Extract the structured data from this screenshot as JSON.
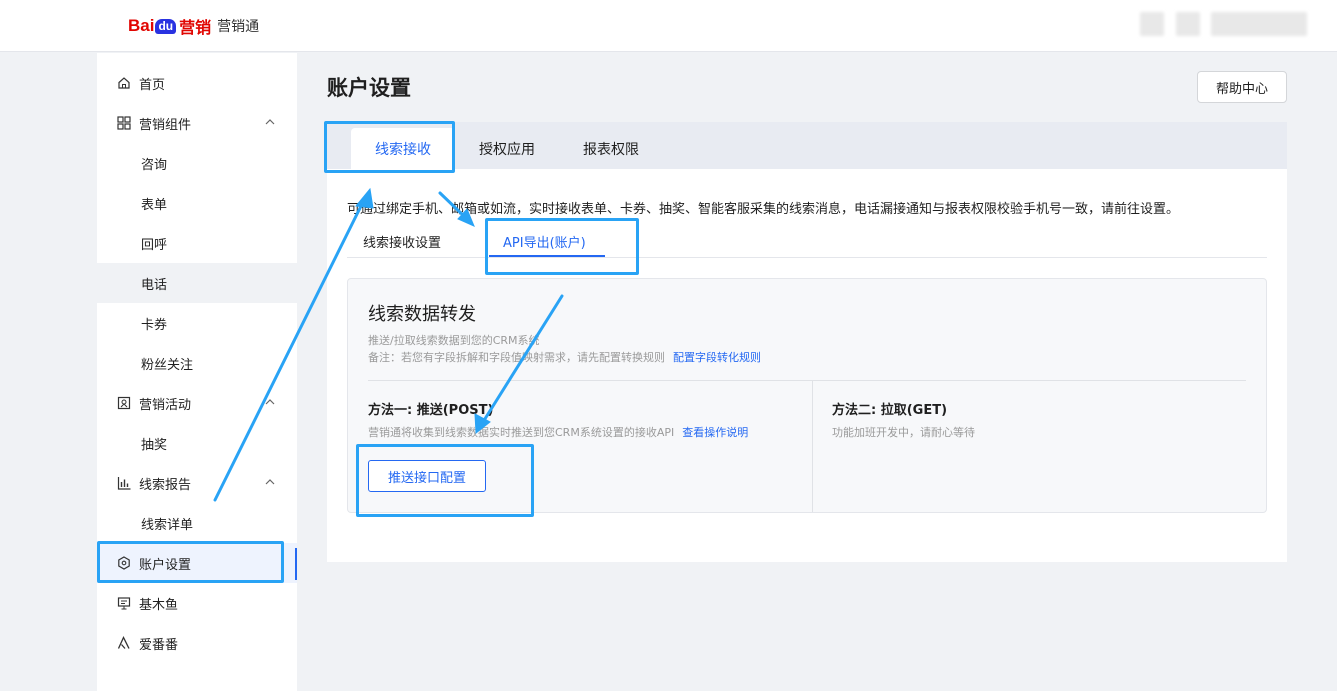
{
  "header": {
    "logo": {
      "bai": "Bai",
      "du": "du",
      "yingxiao": "营销",
      "product": "营销通"
    }
  },
  "sidebar": {
    "items": [
      {
        "label": "首页",
        "icon": "home-icon"
      },
      {
        "label": "营销组件",
        "icon": "grid-icon",
        "expanded": true
      },
      {
        "label": "咨询"
      },
      {
        "label": "表单"
      },
      {
        "label": "回呼"
      },
      {
        "label": "电话"
      },
      {
        "label": "卡券"
      },
      {
        "label": "粉丝关注"
      },
      {
        "label": "营销活动",
        "icon": "activity-icon",
        "expanded": true
      },
      {
        "label": "抽奖"
      },
      {
        "label": "线索报告",
        "icon": "bar-chart-icon",
        "expanded": true
      },
      {
        "label": "线索详单"
      },
      {
        "label": "账户设置",
        "icon": "settings-icon",
        "active": true
      },
      {
        "label": "基木鱼",
        "icon": "monitor-icon"
      },
      {
        "label": "爱番番",
        "icon": "aifanfan-icon"
      }
    ]
  },
  "main": {
    "title": "账户设置",
    "help_label": "帮助中心",
    "tabs": [
      "线索接收",
      "授权应用",
      "报表权限"
    ],
    "notice": "可通过绑定手机、邮箱或如流，实时接收表单、卡券、抽奖、智能客服采集的线索消息，电话漏接通知与报表权限校验手机号一致，请前往设置。",
    "subtabs": [
      "线索接收设置",
      "API导出(账户)"
    ],
    "panel": {
      "title": "线索数据转发",
      "desc1": "推送/拉取线索数据到您的CRM系统",
      "desc2": "备注：若您有字段拆解和字段值映射需求，请先配置转换规则",
      "desc2_link": "配置字段转化规则",
      "method1_title": "方法一: 推送(POST)",
      "method1_desc": "营销通将收集到线索数据实时推送到您CRM系统设置的接收API",
      "method1_link": "查看操作说明",
      "method1_button": "推送接口配置",
      "method2_title": "方法二: 拉取(GET)",
      "method2_desc": "功能加班开发中，请耐心等待"
    }
  },
  "colors": {
    "accent": "#2468f2",
    "annotation": "#29a3f5",
    "brand_red": "#e10602",
    "brand_blue": "#2932e1"
  }
}
